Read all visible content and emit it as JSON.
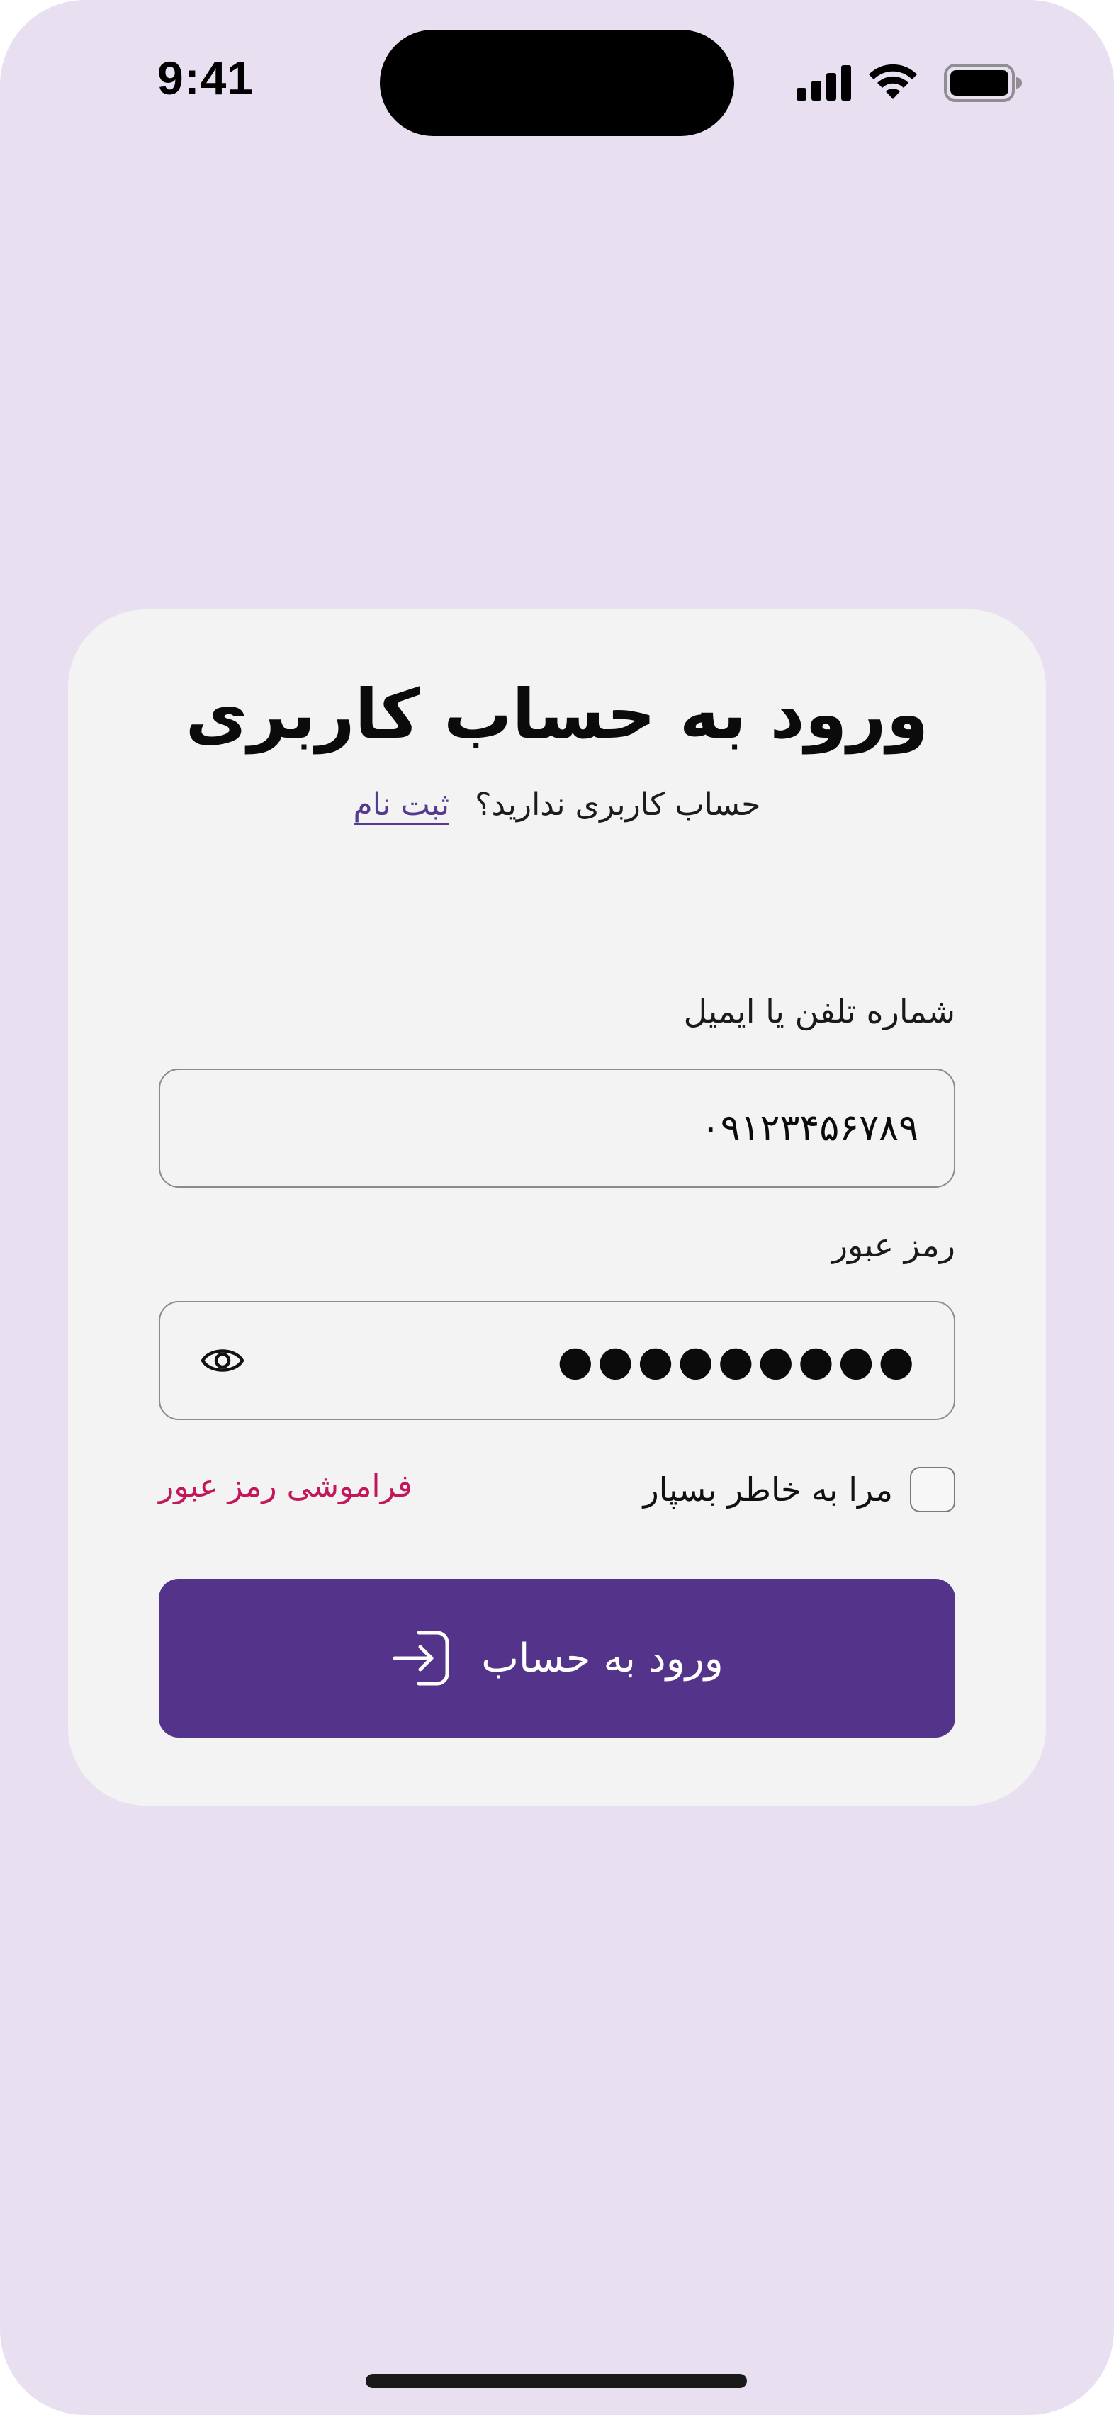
{
  "status_bar": {
    "time": "9:41",
    "icons": [
      "signal-icon",
      "wifi-icon",
      "battery-icon"
    ]
  },
  "login": {
    "title": "ورود به حساب کاربری",
    "subtitle_text": "حساب کاربری ندارید؟",
    "signup_link": "ثبت نام",
    "phone_label": "شماره تلفن یا ایمیل",
    "phone_value": "۰۹۱۲۳۴۵۶۷۸۹",
    "password_label": "رمز عبور",
    "password_value": "●●●●●●●●●",
    "remember_label": "مرا به خاطر بسپار",
    "remember_checked": false,
    "forgot_label": "فراموشی رمز عبور",
    "submit_label": "ورود به حساب"
  },
  "colors": {
    "background": "#e8e0f1",
    "card": "#f3f3f4",
    "primary": "#54348a",
    "link": "#553a8f",
    "forgot": "#c2185b"
  }
}
